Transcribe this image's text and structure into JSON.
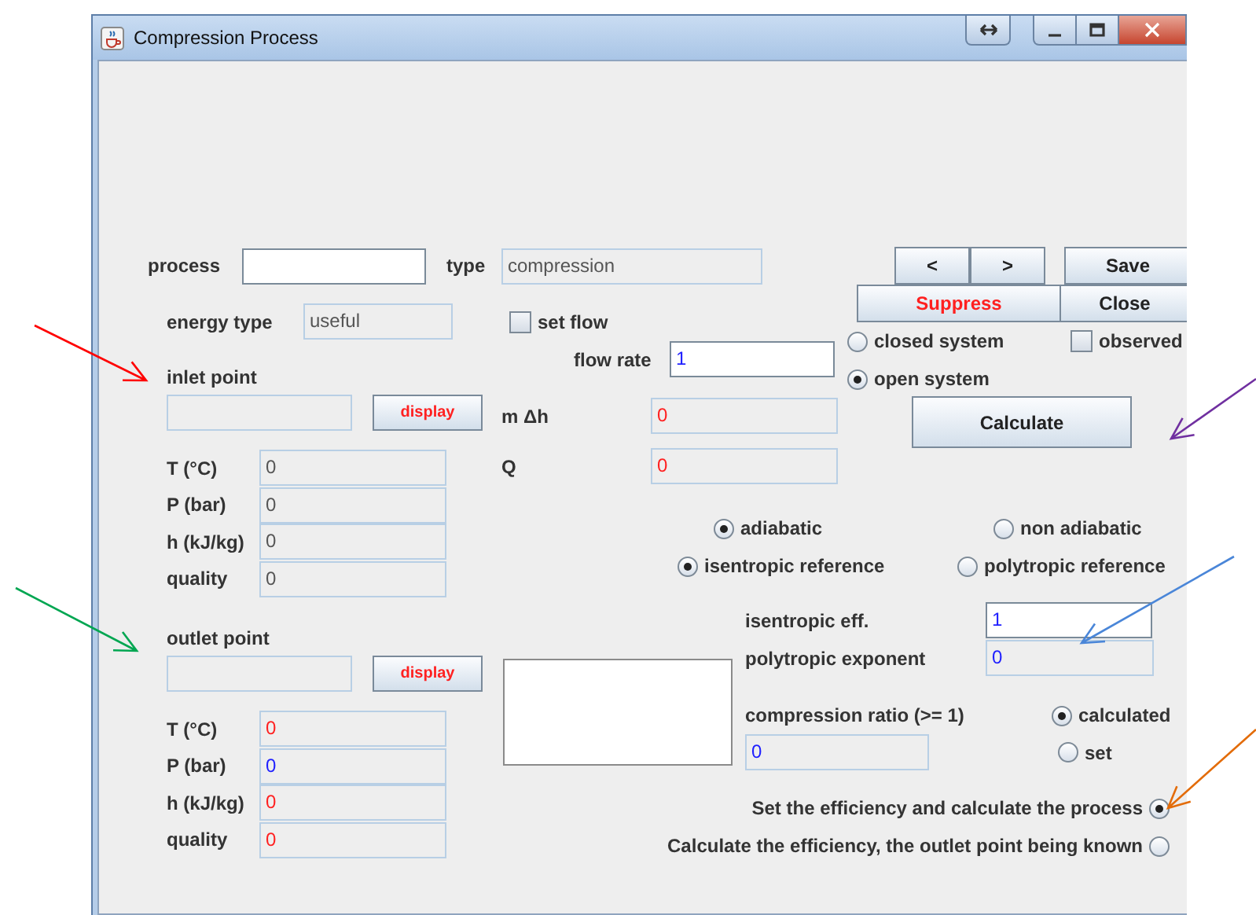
{
  "window": {
    "title": "Compression Process"
  },
  "process": {
    "label": "process"
  },
  "type": {
    "label": "type",
    "value": "compression"
  },
  "energy_type": {
    "label": "energy type",
    "value": "useful"
  },
  "set_flow": {
    "label": "set flow",
    "checked": false
  },
  "flow_rate": {
    "label": "flow rate",
    "value": "1"
  },
  "m_dh": {
    "label": "m Δh",
    "value": "0"
  },
  "q": {
    "label": "Q",
    "value": "0"
  },
  "nav_buttons": [
    "<",
    ">"
  ],
  "save_button": "Save",
  "suppress_button": "Suppress",
  "close_button": "Close",
  "system": [
    {
      "label": "closed system",
      "selected": false
    },
    {
      "label": "open system",
      "selected": true
    }
  ],
  "observed": {
    "label": "observed",
    "checked": false
  },
  "calculate_button": "Calculate",
  "inlet": {
    "title": "inlet point",
    "display_button": "display",
    "properties": [
      {
        "label": "T (°C)",
        "value": "0",
        "color": "#555555"
      },
      {
        "label": "P (bar)",
        "value": "0",
        "color": "#555555"
      },
      {
        "label": "h (kJ/kg)",
        "value": "0",
        "color": "#555555"
      },
      {
        "label": "quality",
        "value": "0",
        "color": "#555555"
      }
    ]
  },
  "outlet": {
    "title": "outlet point",
    "display_button": "display",
    "properties": [
      {
        "label": "T (°C)",
        "value": "0",
        "color": "#ff2020"
      },
      {
        "label": "P (bar)",
        "value": "0",
        "color": "#2020ff"
      },
      {
        "label": "h (kJ/kg)",
        "value": "0",
        "color": "#ff2020"
      },
      {
        "label": "quality",
        "value": "0",
        "color": "#ff2020"
      }
    ]
  },
  "heat": [
    {
      "label": "adiabatic",
      "selected": true
    },
    {
      "label": "non adiabatic",
      "selected": false
    }
  ],
  "reference": [
    {
      "label": "isentropic reference",
      "selected": true
    },
    {
      "label": "polytropic reference",
      "selected": false
    }
  ],
  "isentropic_eff": {
    "label": "isentropic eff.",
    "value": "1"
  },
  "polytropic_exponent": {
    "label": "polytropic exponent",
    "value": "0"
  },
  "compression_ratio": {
    "label": "compression ratio (>= 1)",
    "value": "0"
  },
  "ratio_mode": [
    {
      "label": "calculated",
      "selected": true
    },
    {
      "label": "set",
      "selected": false
    }
  ],
  "mode": [
    {
      "label": "Set the efficiency and calculate the process",
      "selected": true
    },
    {
      "label": "Calculate the efficiency, the outlet point being known",
      "selected": false
    }
  ]
}
